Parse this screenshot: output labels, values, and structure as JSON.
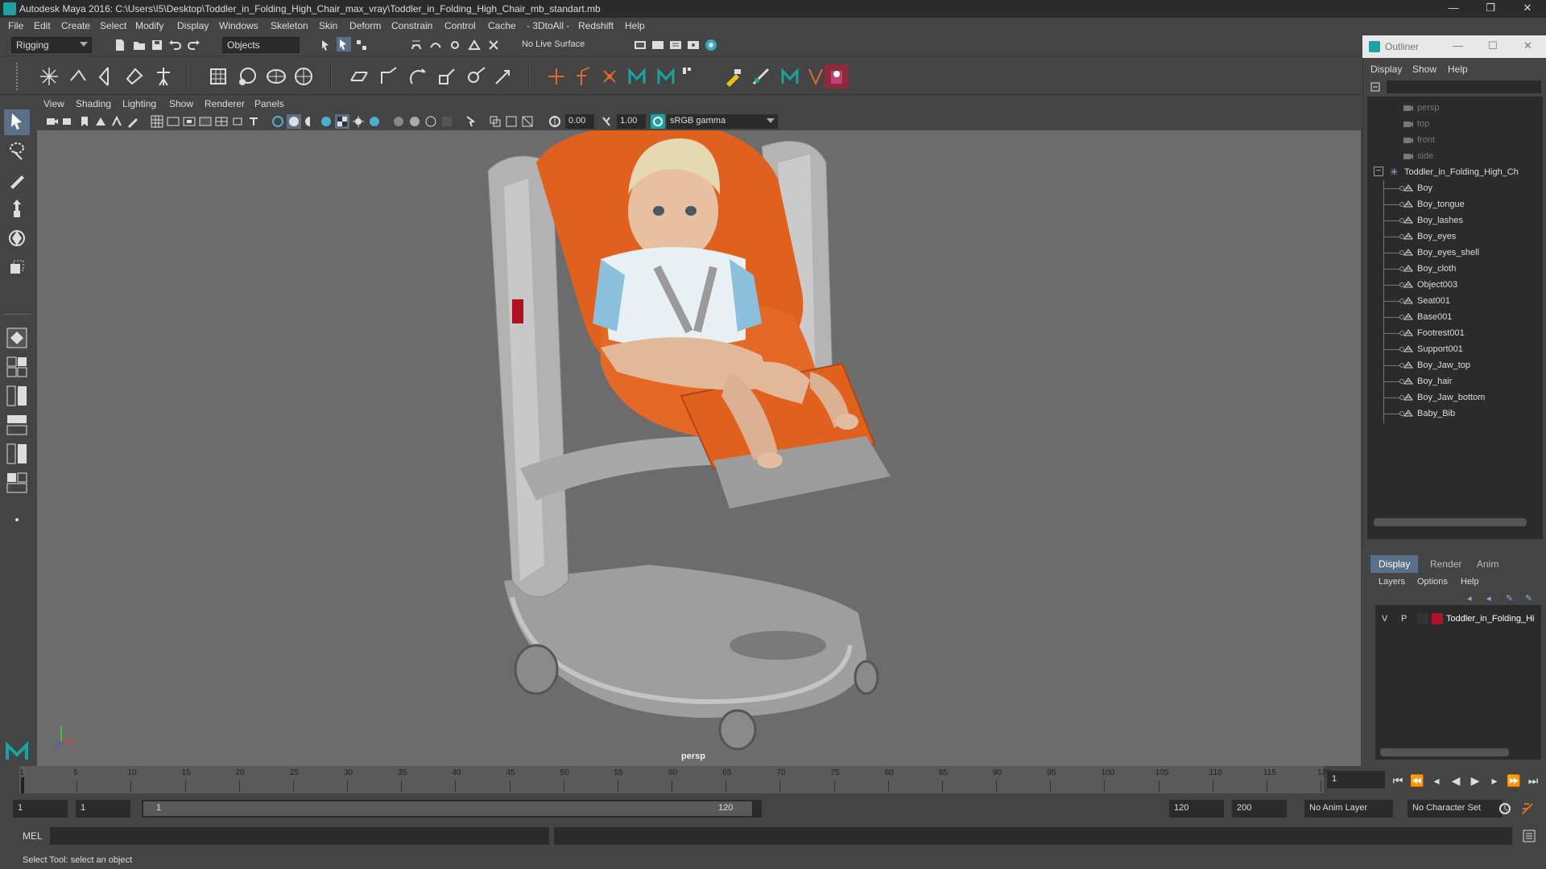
{
  "window": {
    "title": "Autodesk Maya 2016: C:\\Users\\I5\\Desktop\\Toddler_in_Folding_High_Chair_max_vray\\Toddler_in_Folding_High_Chair_mb_standart.mb",
    "minimize_glyph": "—",
    "restore_glyph": "❐",
    "close_glyph": "✕"
  },
  "menubar": [
    "File",
    "Edit",
    "Create",
    "Select",
    "Modify",
    "Display",
    "Windows",
    "Skeleton",
    "Skin",
    "Deform",
    "Constrain",
    "Control",
    "Cache",
    "- 3DtoAll -",
    "Redshift",
    "Help"
  ],
  "statusline": {
    "menuset": "Rigging",
    "selection_mode": "Objects",
    "live_surface": "No Live Surface"
  },
  "panel": {
    "menus": [
      "View",
      "Shading",
      "Lighting",
      "Show",
      "Renderer",
      "Panels"
    ],
    "exposure": "0.00",
    "gamma": "1.00",
    "color_space": "sRGB gamma",
    "camera_label": "persp"
  },
  "outliner": {
    "title": "Outliner",
    "menus": [
      "Display",
      "Show",
      "Help"
    ],
    "cameras": [
      "persp",
      "top",
      "front",
      "side"
    ],
    "group": "Toddler_in_Folding_High_Ch",
    "children": [
      "Boy",
      "Boy_tongue",
      "Boy_lashes",
      "Boy_eyes",
      "Boy_eyes_shell",
      "Boy_cloth",
      "Object003",
      "Seat001",
      "Base001",
      "Footrest001",
      "Support001",
      "Boy_Jaw_top",
      "Boy_hair",
      "Boy_Jaw_bottom",
      "Baby_Bib"
    ]
  },
  "layer_editor": {
    "tabs": [
      "Display",
      "Render",
      "Anim"
    ],
    "menus": [
      "Layers",
      "Options",
      "Help"
    ],
    "layer": {
      "v": "V",
      "p": "P",
      "name": "Toddler_in_Folding_Hi",
      "color": "#b0102a"
    }
  },
  "timeslider": {
    "labels": [
      "1",
      "5",
      "10",
      "15",
      "20",
      "25",
      "30",
      "35",
      "40",
      "45",
      "50",
      "55",
      "60",
      "65",
      "70",
      "75",
      "80",
      "85",
      "90",
      "95",
      "100",
      "105",
      "110",
      "115",
      "120"
    ],
    "current_frame": "1"
  },
  "rangeslider": {
    "start": "1",
    "playback_start": "1",
    "range_start_label": "1",
    "range_end_label": "120",
    "playback_end": "120",
    "end": "200",
    "anim_layer": "No Anim Layer",
    "character_set": "No Character Set"
  },
  "cmdline": {
    "lang": "MEL"
  },
  "helpline": {
    "text": "Select Tool: select an object"
  },
  "colors": {
    "accent": "#5a6f88",
    "seat": "#e0601e",
    "chair": "#a8a8a8",
    "viewport_bg": "#6c6c6c"
  }
}
